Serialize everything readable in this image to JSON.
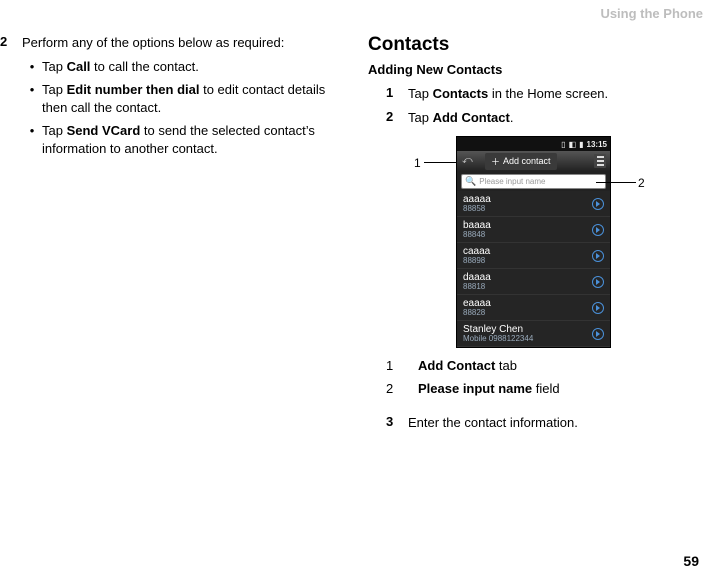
{
  "header": {
    "section_label": "Using the Phone"
  },
  "page_number": "59",
  "left": {
    "step2_num": "2",
    "step2_text": "Perform any of the options below as required:",
    "bullets": [
      {
        "pre": "Tap ",
        "bold": "Call",
        "post": " to call the contact."
      },
      {
        "pre": "Tap ",
        "bold": "Edit number then dial",
        "post": " to edit contact details then call the contact."
      },
      {
        "pre": "Tap ",
        "bold": "Send VCard",
        "post": " to send the selected contact’s information to another contact."
      }
    ]
  },
  "right": {
    "title": "Contacts",
    "subtitle": "Adding New Contacts",
    "step1_num": "1",
    "step1_pre": "Tap ",
    "step1_bold": "Contacts",
    "step1_post": " in the Home screen.",
    "step2_num": "2",
    "step2_pre": "Tap ",
    "step2_bold": "Add Contact",
    "step2_post": ".",
    "callout_1": "1",
    "callout_2": "2",
    "legend": [
      {
        "num": "1",
        "bold": "Add Contact",
        "post": " tab"
      },
      {
        "num": "2",
        "bold": "Please input name",
        "post": " field"
      }
    ],
    "step3_num": "3",
    "step3_text": "Enter the contact information."
  },
  "phone": {
    "statusbar": {
      "time": "13:15"
    },
    "tab_label": "Add contact",
    "search_placeholder": "Please input name",
    "contacts": [
      {
        "name": "aaaaa",
        "sub": "88858"
      },
      {
        "name": "baaaa",
        "sub": "88848"
      },
      {
        "name": "caaaa",
        "sub": "88898"
      },
      {
        "name": "daaaa",
        "sub": "88818"
      },
      {
        "name": "eaaaa",
        "sub": "88828"
      },
      {
        "name": "Stanley Chen",
        "sub": "Mobile 0988122344"
      }
    ]
  }
}
